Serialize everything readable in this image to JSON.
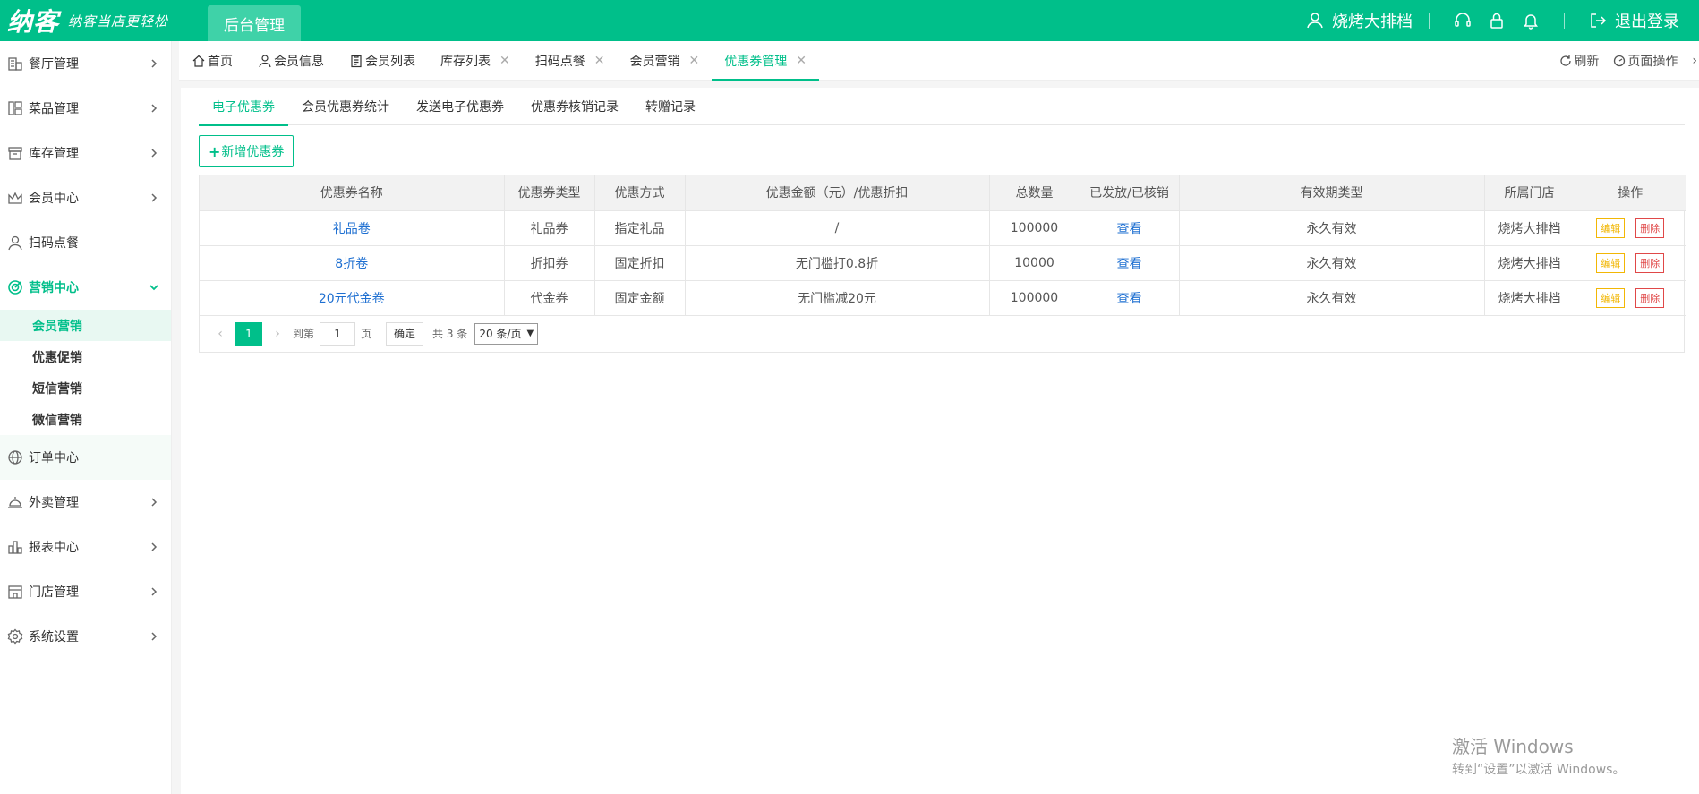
{
  "header": {
    "logo_main": "纳客",
    "logo_slogan": "纳客当店更轻松",
    "app_tab": "后台管理",
    "store_name": "烧烤大排档",
    "logout": "退出登录"
  },
  "sidebar": {
    "items": [
      {
        "label": "餐厅管理"
      },
      {
        "label": "菜品管理"
      },
      {
        "label": "库存管理"
      },
      {
        "label": "会员中心"
      },
      {
        "label": "扫码点餐"
      },
      {
        "label": "营销中心"
      },
      {
        "label": "订单中心"
      },
      {
        "label": "外卖管理"
      },
      {
        "label": "报表中心"
      },
      {
        "label": "门店管理"
      },
      {
        "label": "系统设置"
      }
    ],
    "sub_items": [
      {
        "label": "会员营销"
      },
      {
        "label": "优惠促销"
      },
      {
        "label": "短信营销"
      },
      {
        "label": "微信营销"
      }
    ]
  },
  "tabs": {
    "items": [
      {
        "label": "首页"
      },
      {
        "label": "会员信息"
      },
      {
        "label": "会员列表"
      },
      {
        "label": "库存列表"
      },
      {
        "label": "扫码点餐"
      },
      {
        "label": "会员营销"
      },
      {
        "label": "优惠券管理"
      }
    ],
    "refresh": "刷新",
    "page_ops": "页面操作"
  },
  "subtabs": [
    "电子优惠券",
    "会员优惠券统计",
    "发送电子优惠券",
    "优惠券核销记录",
    "转赠记录"
  ],
  "add_button": "新增优惠券",
  "table": {
    "headers": [
      "优惠券名称",
      "优惠券类型",
      "优惠方式",
      "优惠金额（元）/优惠折扣",
      "总数量",
      "已发放/已核销",
      "有效期类型",
      "所属门店",
      "操作"
    ],
    "rows": [
      {
        "name": "礼品卷",
        "type": "礼品券",
        "method": "指定礼品",
        "amount": "/",
        "total": "100000",
        "issued": "查看",
        "validity": "永久有效",
        "store": "烧烤大排档",
        "edit": "编辑",
        "delete": "删除"
      },
      {
        "name": "8折卷",
        "type": "折扣券",
        "method": "固定折扣",
        "amount": "无门槛打0.8折",
        "total": "10000",
        "issued": "查看",
        "validity": "永久有效",
        "store": "烧烤大排档",
        "edit": "编辑",
        "delete": "删除"
      },
      {
        "name": "20元代金卷",
        "type": "代金券",
        "method": "固定金额",
        "amount": "无门槛减20元",
        "total": "100000",
        "issued": "查看",
        "validity": "永久有效",
        "store": "烧烤大排档",
        "edit": "编辑",
        "delete": "删除"
      }
    ]
  },
  "pager": {
    "current_page": "1",
    "goto_label": "到第",
    "page_input": "1",
    "page_unit": "页",
    "confirm": "确定",
    "total": "共 3 条",
    "page_size": "20 条/页"
  },
  "watermark": {
    "line1": "激活 Windows",
    "line2": "转到“设置”以激活 Windows。"
  },
  "colors": {
    "brand": "#00bf8a",
    "link": "#1e6fd1",
    "edit": "#f2b705",
    "delete": "#e04848"
  }
}
